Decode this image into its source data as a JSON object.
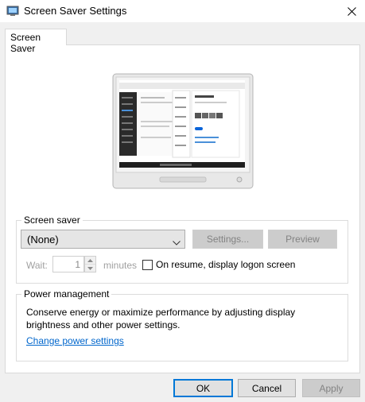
{
  "window": {
    "title": "Screen Saver Settings",
    "app_icon": "screen-saver-app-icon",
    "close_icon": "close-icon"
  },
  "tabs": [
    {
      "label": "Screen Saver",
      "selected": true
    }
  ],
  "screen_saver": {
    "group_label": "Screen saver",
    "selected": "(None)",
    "settings_label": "Settings...",
    "preview_label": "Preview",
    "wait_label": "Wait:",
    "wait_value": "1",
    "minutes_label": "minutes",
    "logon_label": "On resume, display logon screen",
    "logon_checked": false
  },
  "power": {
    "group_label": "Power management",
    "description": "Conserve energy or maximize performance by adjusting display brightness and other power settings.",
    "link_label": "Change power settings"
  },
  "buttons": {
    "ok": "OK",
    "cancel": "Cancel",
    "apply": "Apply"
  },
  "colors": {
    "link": "#0066cc",
    "focus_border": "#0078d7",
    "dialog_bg": "#f0f0f0"
  }
}
